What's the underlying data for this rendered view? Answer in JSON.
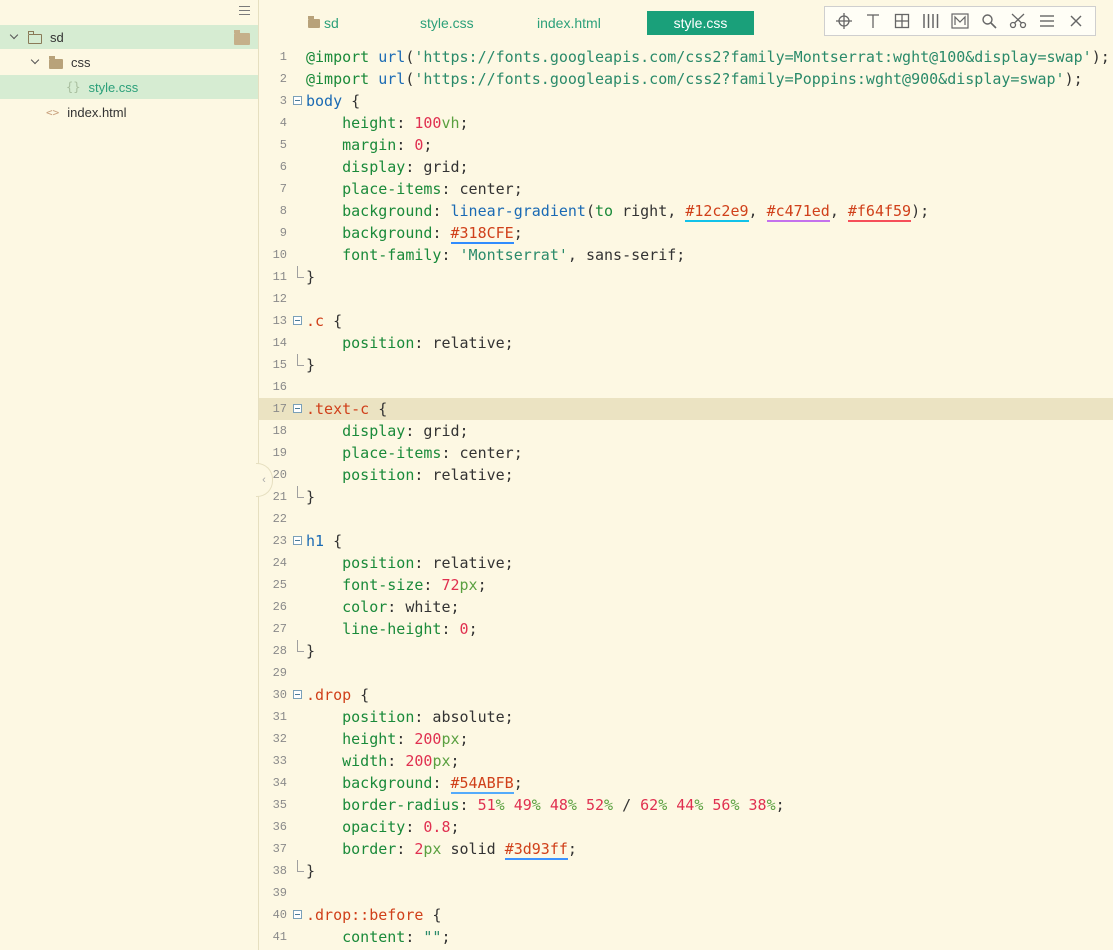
{
  "sidebar": {
    "tree": [
      {
        "label": "sd",
        "level": 0,
        "kind": "folder",
        "expanded": true,
        "active": true
      },
      {
        "label": "css",
        "level": 1,
        "kind": "folder",
        "expanded": true,
        "active": false
      },
      {
        "label": "style.css",
        "level": 2,
        "kind": "css",
        "active": true
      },
      {
        "label": "index.html",
        "level": 1,
        "kind": "html",
        "active": false
      }
    ]
  },
  "tabs": [
    {
      "label": "sd",
      "icon": "folder-icon",
      "active": false
    },
    {
      "label": "style.css",
      "active": false
    },
    {
      "label": "index.html",
      "active": false
    },
    {
      "label": "style.css",
      "active": true
    }
  ],
  "toolbar": {
    "icons": [
      "crosshair-icon",
      "text-cursor-icon",
      "grid-icon",
      "columns-icon",
      "markdown-icon",
      "search-icon",
      "cut-icon",
      "menu-icon",
      "close-icon"
    ]
  },
  "colors": {
    "accent": "#1aa07a",
    "background": "#fdf8e3",
    "active_row": "#d6ecd2",
    "swatches": {
      "12c2e9": "#12c2e9",
      "c471ed": "#c471ed",
      "f64f59": "#f64f59",
      "318CFE": "#318CFE",
      "54ABFB": "#54ABFB",
      "3d93ff": "#3d93ff"
    }
  },
  "editor": {
    "highlighted_line": 17,
    "lines": [
      {
        "n": "1",
        "tokens": [
          [
            "c-key",
            "@import "
          ],
          [
            "c-fn",
            "url"
          ],
          [
            "c-punc",
            "("
          ],
          [
            "c-str",
            "'https://fonts.googleapis.com/css2?family=Montserrat:wght@100&display=swap'"
          ],
          [
            "c-punc",
            ");"
          ]
        ]
      },
      {
        "n": "2",
        "tokens": [
          [
            "c-key",
            "@import "
          ],
          [
            "c-fn",
            "url"
          ],
          [
            "c-punc",
            "("
          ],
          [
            "c-str",
            "'https://fonts.googleapis.com/css2?family=Poppins:wght@900&display=swap'"
          ],
          [
            "c-punc",
            ");"
          ]
        ]
      },
      {
        "n": "3",
        "fold": "start",
        "tokens": [
          [
            "c-blue-sel",
            "body"
          ],
          [
            "c-punc",
            " {"
          ]
        ]
      },
      {
        "n": "4",
        "tokens": [
          [
            "c-punc",
            "    "
          ],
          [
            "c-key",
            "height"
          ],
          [
            "c-punc",
            ": "
          ],
          [
            "c-num",
            "100"
          ],
          [
            "c-unit",
            "vh"
          ],
          [
            "c-punc",
            ";"
          ]
        ]
      },
      {
        "n": "5",
        "tokens": [
          [
            "c-punc",
            "    "
          ],
          [
            "c-key",
            "margin"
          ],
          [
            "c-punc",
            ": "
          ],
          [
            "c-num",
            "0"
          ],
          [
            "c-punc",
            ";"
          ]
        ]
      },
      {
        "n": "6",
        "tokens": [
          [
            "c-punc",
            "    "
          ],
          [
            "c-key",
            "display"
          ],
          [
            "c-punc",
            ": grid;"
          ]
        ]
      },
      {
        "n": "7",
        "tokens": [
          [
            "c-punc",
            "    "
          ],
          [
            "c-key",
            "place-items"
          ],
          [
            "c-punc",
            ": center;"
          ]
        ]
      },
      {
        "n": "8",
        "tokens": [
          [
            "c-punc",
            "    "
          ],
          [
            "c-key",
            "background"
          ],
          [
            "c-punc",
            ": "
          ],
          [
            "c-fn",
            "linear-gradient"
          ],
          [
            "c-punc",
            "("
          ],
          [
            "c-key",
            "to"
          ],
          [
            "c-punc",
            " right, "
          ],
          [
            "c-hex u1",
            "#12c2e9"
          ],
          [
            "c-punc",
            ", "
          ],
          [
            "c-hex u2",
            "#c471ed"
          ],
          [
            "c-punc",
            ", "
          ],
          [
            "c-hex u3",
            "#f64f59"
          ],
          [
            "c-punc",
            ");"
          ]
        ]
      },
      {
        "n": "9",
        "tokens": [
          [
            "c-punc",
            "    "
          ],
          [
            "c-key",
            "background"
          ],
          [
            "c-punc",
            ": "
          ],
          [
            "c-hex u4",
            "#318CFE"
          ],
          [
            "c-punc",
            ";"
          ]
        ]
      },
      {
        "n": "10",
        "tokens": [
          [
            "c-punc",
            "    "
          ],
          [
            "c-key",
            "font-family"
          ],
          [
            "c-punc",
            ": "
          ],
          [
            "c-str",
            "'Montserrat'"
          ],
          [
            "c-punc",
            ", sans-serif;"
          ]
        ]
      },
      {
        "n": "11",
        "fold": "end",
        "tokens": [
          [
            "c-punc",
            "}"
          ]
        ]
      },
      {
        "n": "12",
        "tokens": []
      },
      {
        "n": "13",
        "fold": "start",
        "tokens": [
          [
            "c-sel",
            ".c"
          ],
          [
            "c-punc",
            " {"
          ]
        ]
      },
      {
        "n": "14",
        "tokens": [
          [
            "c-punc",
            "    "
          ],
          [
            "c-key",
            "position"
          ],
          [
            "c-punc",
            ": relative;"
          ]
        ]
      },
      {
        "n": "15",
        "fold": "end",
        "tokens": [
          [
            "c-punc",
            "}"
          ]
        ]
      },
      {
        "n": "16",
        "tokens": []
      },
      {
        "n": "17",
        "fold": "start",
        "tokens": [
          [
            "c-sel",
            ".text-c"
          ],
          [
            "c-punc",
            " {"
          ]
        ]
      },
      {
        "n": "18",
        "tokens": [
          [
            "c-punc",
            "    "
          ],
          [
            "c-key",
            "display"
          ],
          [
            "c-punc",
            ": grid;"
          ]
        ]
      },
      {
        "n": "19",
        "tokens": [
          [
            "c-punc",
            "    "
          ],
          [
            "c-key",
            "place-items"
          ],
          [
            "c-punc",
            ": center;"
          ]
        ]
      },
      {
        "n": "20",
        "tokens": [
          [
            "c-punc",
            "    "
          ],
          [
            "c-key",
            "position"
          ],
          [
            "c-punc",
            ": relative;"
          ]
        ]
      },
      {
        "n": "21",
        "fold": "end",
        "tokens": [
          [
            "c-punc",
            "}"
          ]
        ]
      },
      {
        "n": "22",
        "tokens": []
      },
      {
        "n": "23",
        "fold": "start",
        "tokens": [
          [
            "c-blue-sel",
            "h1"
          ],
          [
            "c-punc",
            " {"
          ]
        ]
      },
      {
        "n": "24",
        "tokens": [
          [
            "c-punc",
            "    "
          ],
          [
            "c-key",
            "position"
          ],
          [
            "c-punc",
            ": relative;"
          ]
        ]
      },
      {
        "n": "25",
        "tokens": [
          [
            "c-punc",
            "    "
          ],
          [
            "c-key",
            "font-size"
          ],
          [
            "c-punc",
            ": "
          ],
          [
            "c-num",
            "72"
          ],
          [
            "c-unit",
            "px"
          ],
          [
            "c-punc",
            ";"
          ]
        ]
      },
      {
        "n": "26",
        "tokens": [
          [
            "c-punc",
            "    "
          ],
          [
            "c-key",
            "color"
          ],
          [
            "c-punc",
            ": white;"
          ]
        ]
      },
      {
        "n": "27",
        "tokens": [
          [
            "c-punc",
            "    "
          ],
          [
            "c-key",
            "line-height"
          ],
          [
            "c-punc",
            ": "
          ],
          [
            "c-num",
            "0"
          ],
          [
            "c-punc",
            ";"
          ]
        ]
      },
      {
        "n": "28",
        "fold": "end",
        "tokens": [
          [
            "c-punc",
            "}"
          ]
        ]
      },
      {
        "n": "29",
        "tokens": []
      },
      {
        "n": "30",
        "fold": "start",
        "tokens": [
          [
            "c-sel",
            ".drop"
          ],
          [
            "c-punc",
            " {"
          ]
        ]
      },
      {
        "n": "31",
        "tokens": [
          [
            "c-punc",
            "    "
          ],
          [
            "c-key",
            "position"
          ],
          [
            "c-punc",
            ": absolute;"
          ]
        ]
      },
      {
        "n": "32",
        "tokens": [
          [
            "c-punc",
            "    "
          ],
          [
            "c-key",
            "height"
          ],
          [
            "c-punc",
            ": "
          ],
          [
            "c-num",
            "200"
          ],
          [
            "c-unit",
            "px"
          ],
          [
            "c-punc",
            ";"
          ]
        ]
      },
      {
        "n": "33",
        "tokens": [
          [
            "c-punc",
            "    "
          ],
          [
            "c-key",
            "width"
          ],
          [
            "c-punc",
            ": "
          ],
          [
            "c-num",
            "200"
          ],
          [
            "c-unit",
            "px"
          ],
          [
            "c-punc",
            ";"
          ]
        ]
      },
      {
        "n": "34",
        "tokens": [
          [
            "c-punc",
            "    "
          ],
          [
            "c-key",
            "background"
          ],
          [
            "c-punc",
            ": "
          ],
          [
            "c-hex u5",
            "#54ABFB"
          ],
          [
            "c-punc",
            ";"
          ]
        ]
      },
      {
        "n": "35",
        "tokens": [
          [
            "c-punc",
            "    "
          ],
          [
            "c-key",
            "border-radius"
          ],
          [
            "c-punc",
            ": "
          ],
          [
            "c-num",
            "51"
          ],
          [
            "c-unit",
            "%"
          ],
          [
            "c-punc",
            " "
          ],
          [
            "c-num",
            "49"
          ],
          [
            "c-unit",
            "%"
          ],
          [
            "c-punc",
            " "
          ],
          [
            "c-num",
            "48"
          ],
          [
            "c-unit",
            "%"
          ],
          [
            "c-punc",
            " "
          ],
          [
            "c-num",
            "52"
          ],
          [
            "c-unit",
            "%"
          ],
          [
            "c-punc",
            " / "
          ],
          [
            "c-num",
            "62"
          ],
          [
            "c-unit",
            "%"
          ],
          [
            "c-punc",
            " "
          ],
          [
            "c-num",
            "44"
          ],
          [
            "c-unit",
            "%"
          ],
          [
            "c-punc",
            " "
          ],
          [
            "c-num",
            "56"
          ],
          [
            "c-unit",
            "%"
          ],
          [
            "c-punc",
            " "
          ],
          [
            "c-num",
            "38"
          ],
          [
            "c-unit",
            "%"
          ],
          [
            "c-punc",
            ";"
          ]
        ]
      },
      {
        "n": "36",
        "tokens": [
          [
            "c-punc",
            "    "
          ],
          [
            "c-key",
            "opacity"
          ],
          [
            "c-punc",
            ": "
          ],
          [
            "c-num",
            "0.8"
          ],
          [
            "c-punc",
            ";"
          ]
        ]
      },
      {
        "n": "37",
        "tokens": [
          [
            "c-punc",
            "    "
          ],
          [
            "c-key",
            "border"
          ],
          [
            "c-punc",
            ": "
          ],
          [
            "c-num",
            "2"
          ],
          [
            "c-unit",
            "px"
          ],
          [
            "c-punc",
            " solid "
          ],
          [
            "c-hex u6",
            "#3d93ff"
          ],
          [
            "c-punc",
            ";"
          ]
        ]
      },
      {
        "n": "38",
        "fold": "end",
        "tokens": [
          [
            "c-punc",
            "}"
          ]
        ]
      },
      {
        "n": "39",
        "tokens": []
      },
      {
        "n": "40",
        "fold": "start",
        "tokens": [
          [
            "c-sel",
            ".drop::before"
          ],
          [
            "c-punc",
            " {"
          ]
        ]
      },
      {
        "n": "41",
        "tokens": [
          [
            "c-punc",
            "    "
          ],
          [
            "c-key",
            "content"
          ],
          [
            "c-punc",
            ": "
          ],
          [
            "c-str",
            "\"\""
          ],
          [
            "c-punc",
            ";"
          ]
        ]
      }
    ]
  }
}
